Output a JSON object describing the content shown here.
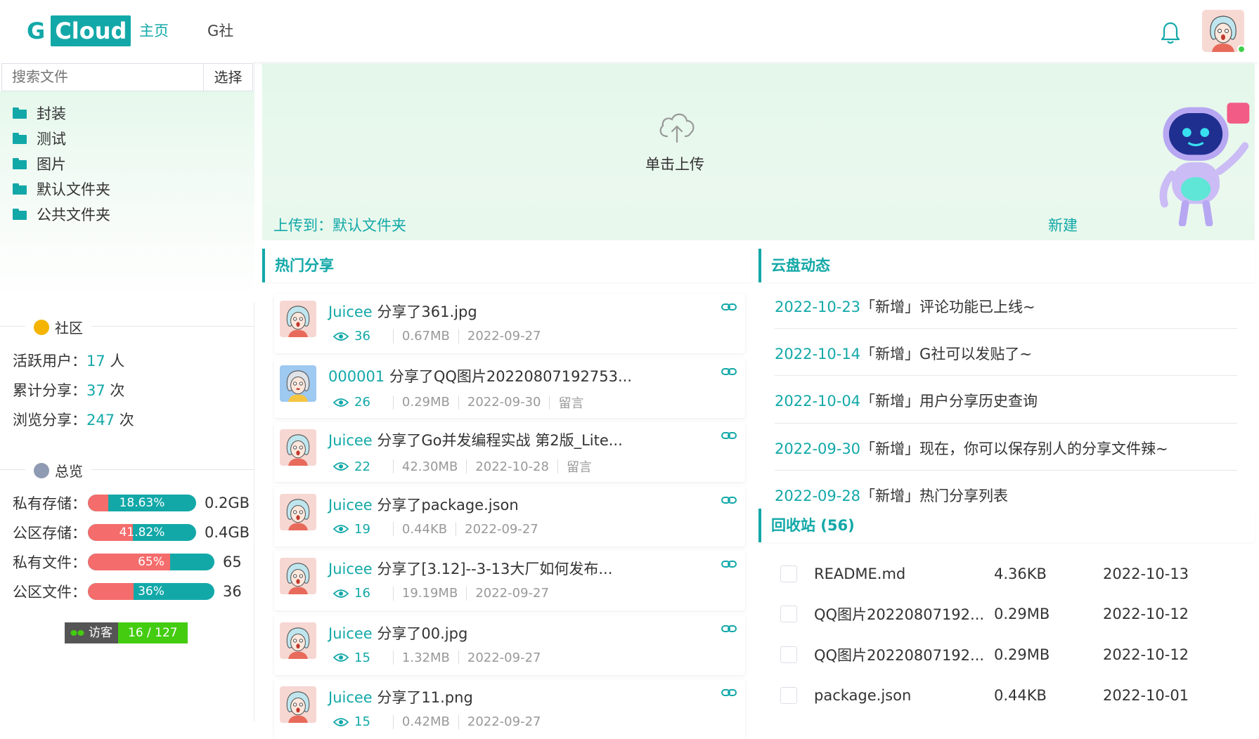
{
  "header": {
    "logo_g": "G",
    "logo_cloud": "Cloud",
    "nav": [
      "主页",
      "G社"
    ]
  },
  "sidebar": {
    "search_placeholder": "搜索文件",
    "search_button": "选择",
    "folders": [
      "封装",
      "测试",
      "图片",
      "默认文件夹",
      "公共文件夹"
    ],
    "community_label": "社区",
    "stats": [
      {
        "label": "活跃用户：",
        "value": "17",
        "unit": " 人"
      },
      {
        "label": "累计分享：",
        "value": "37",
        "unit": " 次"
      },
      {
        "label": "浏览分享：",
        "value": "247",
        "unit": " 次"
      }
    ],
    "overview_label": "总览",
    "usage": [
      {
        "label": "私有存储：",
        "pct_text": "18.63%",
        "pct": 18.63,
        "value": "0.2GB"
      },
      {
        "label": "公区存储：",
        "pct_text": "41.82%",
        "pct": 41.82,
        "value": "0.4GB"
      },
      {
        "label": "私有文件：",
        "pct_text": "65%",
        "pct": 65,
        "value": "65"
      },
      {
        "label": "公区文件：",
        "pct_text": "36%",
        "pct": 36,
        "value": "36"
      }
    ],
    "visitor_label": "访客",
    "visitor_count": "16 / 127"
  },
  "upload": {
    "text": "单击上传",
    "upload_to": "上传到：默认文件夹",
    "new": "新建"
  },
  "hot_share": {
    "title": "热门分享",
    "items": [
      {
        "user": "Juicee",
        "action": " 分享了361.jpg",
        "views": "36",
        "size": "0.67MB",
        "date": "2022-09-27",
        "comment": ""
      },
      {
        "user": "000001",
        "action": " 分享了QQ图片20220807192753...",
        "views": "26",
        "size": "0.29MB",
        "date": "2022-09-30",
        "comment": "留言"
      },
      {
        "user": "Juicee",
        "action": " 分享了Go并发编程实战 第2版_Lite...",
        "views": "22",
        "size": "42.30MB",
        "date": "2022-10-28",
        "comment": "留言"
      },
      {
        "user": "Juicee",
        "action": " 分享了package.json",
        "views": "19",
        "size": "0.44KB",
        "date": "2022-09-27",
        "comment": ""
      },
      {
        "user": "Juicee",
        "action": " 分享了[3.12]--3-13大厂如何发布...",
        "views": "16",
        "size": "19.19MB",
        "date": "2022-09-27",
        "comment": ""
      },
      {
        "user": "Juicee",
        "action": " 分享了00.jpg",
        "views": "15",
        "size": "1.32MB",
        "date": "2022-09-27",
        "comment": ""
      },
      {
        "user": "Juicee",
        "action": " 分享了11.png",
        "views": "15",
        "size": "0.42MB",
        "date": "2022-09-27",
        "comment": ""
      }
    ]
  },
  "news": {
    "title": "云盘动态",
    "items": [
      {
        "date": "2022-10-23",
        "text": "「新增」评论功能已上线~"
      },
      {
        "date": "2022-10-14",
        "text": "「新增」G社可以发贴了~"
      },
      {
        "date": "2022-10-04",
        "text": "「新增」用户分享历史查询"
      },
      {
        "date": "2022-09-30",
        "text": "「新增」现在，你可以保存别人的分享文件辣~"
      },
      {
        "date": "2022-09-28",
        "text": "「新增」热门分享列表"
      }
    ]
  },
  "recycle": {
    "title": "回收站 (56)",
    "items": [
      {
        "name": "README.md",
        "size": "4.36KB",
        "date": "2022-10-13"
      },
      {
        "name": "QQ图片20220807192...",
        "size": "0.29MB",
        "date": "2022-10-12"
      },
      {
        "name": "QQ图片20220807192...",
        "size": "0.29MB",
        "date": "2022-10-12"
      },
      {
        "name": "package.json",
        "size": "0.44KB",
        "date": "2022-10-01"
      }
    ]
  },
  "colors": {
    "accent": "#13a8a8",
    "danger": "#f56c6c",
    "badge_green": "#44cc11"
  },
  "icons": [
    "bell-icon",
    "folder-icon",
    "cloud-upload-icon",
    "eye-icon",
    "link-icon",
    "robot-illustration"
  ]
}
